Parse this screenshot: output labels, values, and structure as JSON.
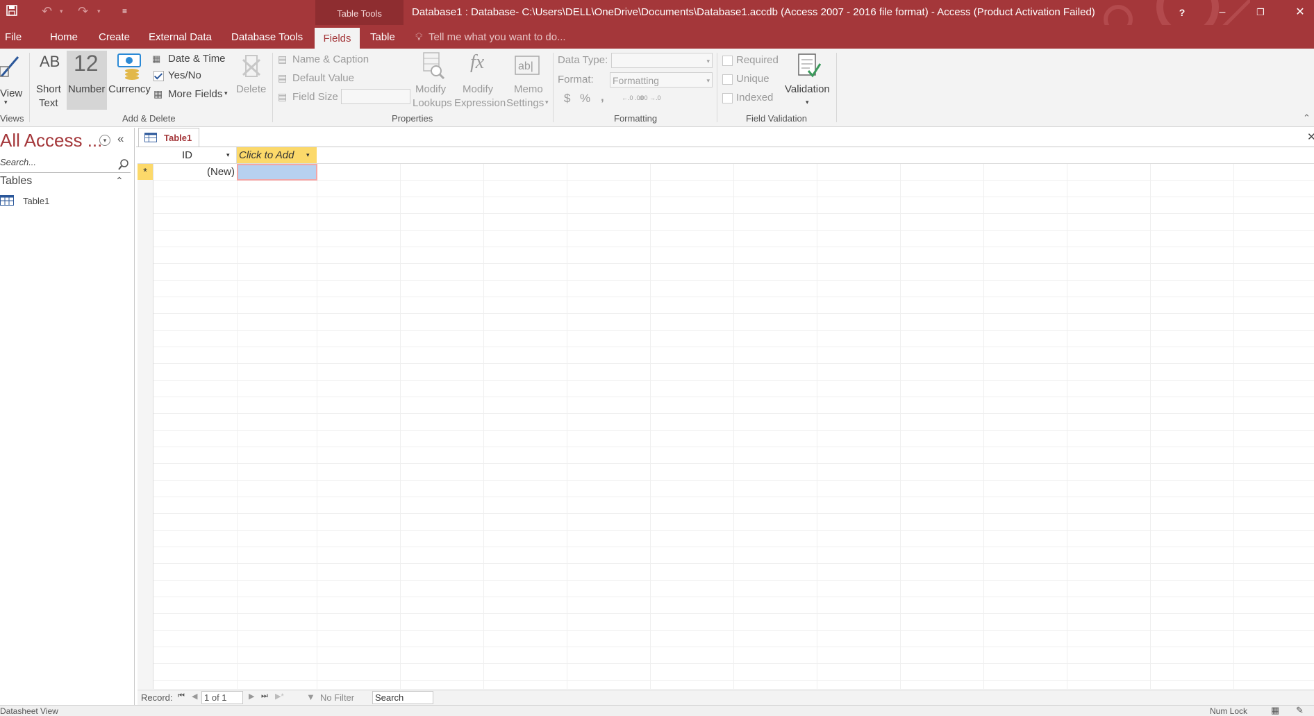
{
  "title_bar": {
    "contextual_tab_header": "Table Tools",
    "window_title": "Database1 : Database- C:\\Users\\DELL\\OneDrive\\Documents\\Database1.accdb (Access 2007 - 2016 file format) - Access (Product Activation Failed)",
    "help": "?",
    "minimize": "–",
    "restore": "❐",
    "close": "✕"
  },
  "tabs": {
    "file": "File",
    "home": "Home",
    "create": "Create",
    "external_data": "External Data",
    "database_tools": "Database Tools",
    "fields": "Fields",
    "table": "Table",
    "tell_me": "Tell me what you want to do..."
  },
  "ribbon": {
    "views": {
      "view_label": "View",
      "group": "Views"
    },
    "add_delete": {
      "ab_glyph": "AB",
      "short_text_1": "Short",
      "short_text_2": "Text",
      "number_glyph": "12",
      "number": "Number",
      "currency": "Currency",
      "date_time": "Date & Time",
      "yes_no": "Yes/No",
      "more_fields": "More Fields",
      "delete": "Delete",
      "group": "Add & Delete"
    },
    "properties": {
      "name_caption": "Name & Caption",
      "default_value": "Default Value",
      "field_size": "Field Size",
      "modify_lookups_1": "Modify",
      "modify_lookups_2": "Lookups",
      "modify_expression_1": "Modify",
      "modify_expression_2": "Expression",
      "memo_settings_1": "Memo",
      "memo_settings_2": "Settings",
      "group": "Properties"
    },
    "formatting": {
      "data_type_label": "Data Type:",
      "data_type_value": "",
      "format_label": "Format:",
      "format_value": "Formatting",
      "currency_symbol": "$",
      "percent_symbol": "%",
      "comma_symbol": ",",
      "inc_decimals": "←.0 .00",
      "dec_decimals": ".00 →.0",
      "group": "Formatting"
    },
    "field_validation": {
      "required": "Required",
      "unique": "Unique",
      "indexed": "Indexed",
      "validation": "Validation",
      "group": "Field Validation"
    }
  },
  "nav_pane": {
    "title": "All Access ...",
    "search_placeholder": "Search...",
    "group_header": "Tables",
    "items": [
      {
        "label": "Table1"
      }
    ]
  },
  "document": {
    "tab_label": "Table1",
    "columns": [
      {
        "label": "ID"
      },
      {
        "label": "Click to Add"
      }
    ],
    "new_row_marker": "*",
    "new_row_id": "(New)"
  },
  "record_nav": {
    "record_label": "Record:",
    "position": "1 of 1",
    "filter": "No Filter",
    "search": "Search"
  },
  "status_bar": {
    "view_mode": "Datasheet View",
    "num_lock": "Num Lock"
  },
  "colors": {
    "accent": "#a4373a",
    "ribbon_bg": "#f3f3f3",
    "selected_cell": "#b7d1f0",
    "add_column_header": "#fcd96a"
  }
}
